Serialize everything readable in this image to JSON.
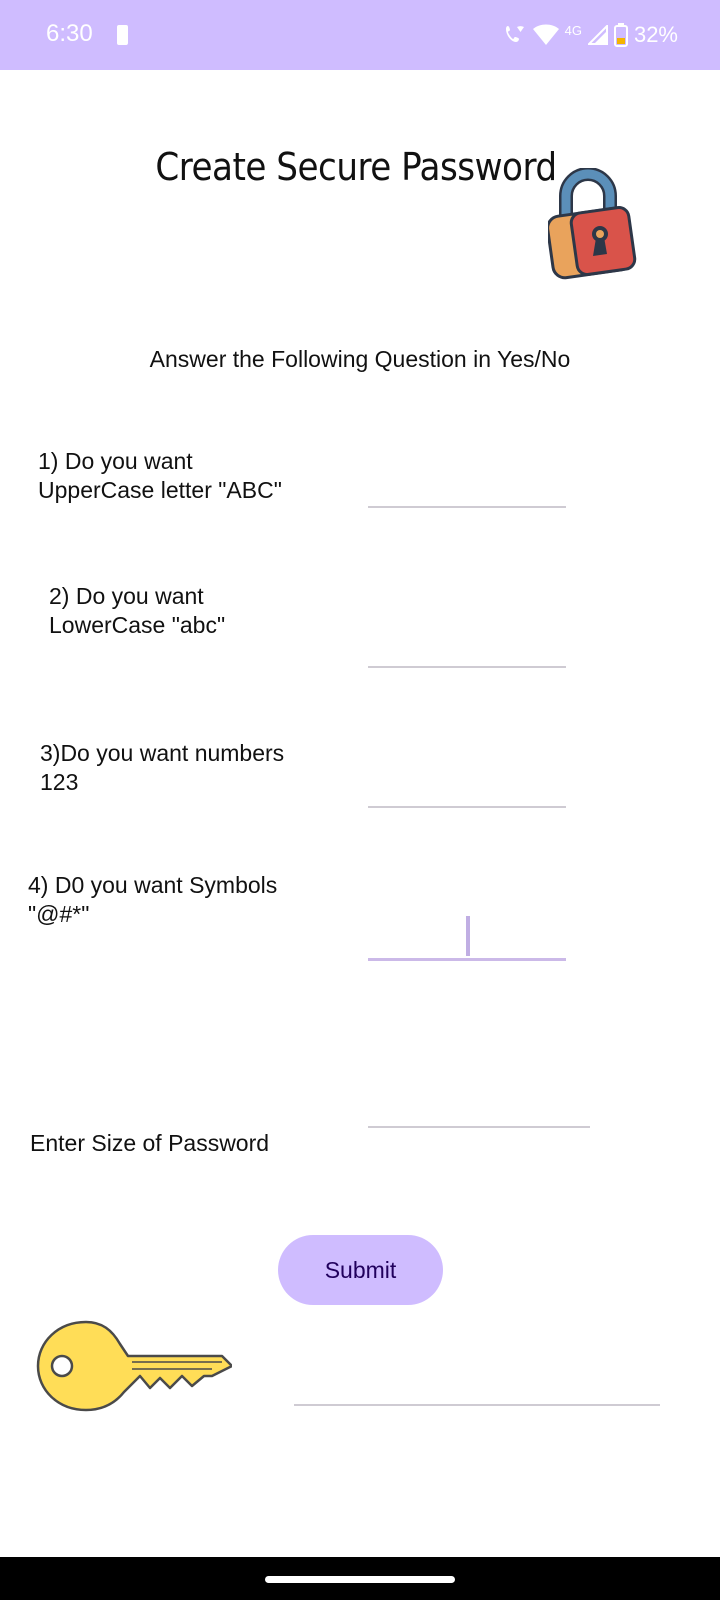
{
  "status_bar": {
    "time": "6:30",
    "network": "4G",
    "battery": "32%"
  },
  "title": "Create Secure Password",
  "subtitle": "Answer the Following Question in Yes/No",
  "questions": [
    {
      "label": "1) Do you want\nUpperCase letter \"ABC\"",
      "value": ""
    },
    {
      "label": "2) Do you want\nLowerCase \"abc\"",
      "value": ""
    },
    {
      "label": "3)Do you want numbers\n123",
      "value": ""
    },
    {
      "label": "4) D0 you want Symbols\n\"@#*\"",
      "value": ""
    }
  ],
  "size_label": "Enter Size of Password",
  "size_value": "",
  "submit_label": "Submit",
  "result_value": "",
  "colors": {
    "accent": "#cfbcff",
    "button_text": "#21005d",
    "lock_body": "#d9534a",
    "lock_shackle": "#5b8fb9",
    "key": "#ffdd57"
  },
  "icons": [
    "lock-icon",
    "key-icon",
    "wifi-icon",
    "signal-icon",
    "battery-icon",
    "phone-wifi-icon"
  ]
}
